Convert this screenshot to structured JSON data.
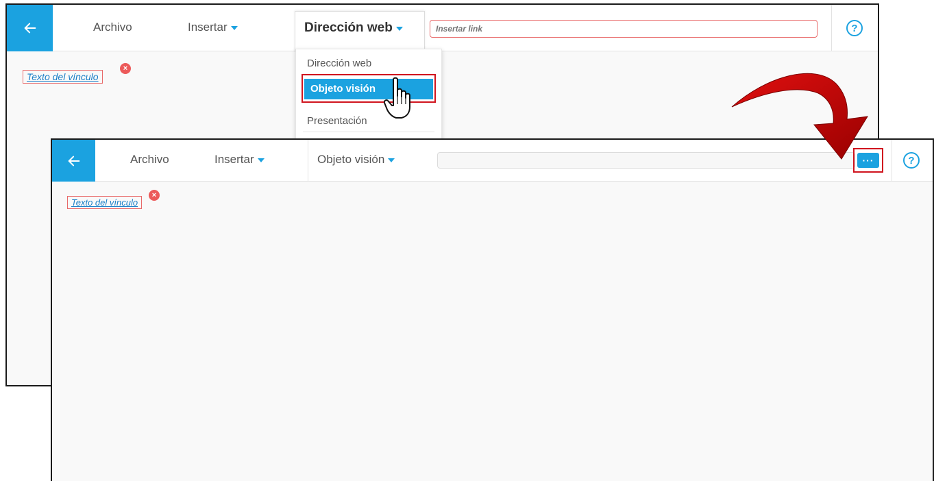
{
  "window1": {
    "menu": {
      "archivo": "Archivo",
      "insertar": "Insertar",
      "direccion_web": "Dirección web"
    },
    "url_input": {
      "placeholder": "Insertar link"
    },
    "dropdown": {
      "items": [
        "Dirección web",
        "Objeto visión",
        "Presentación"
      ]
    },
    "link_chip": {
      "text": "Texto del vínculo",
      "close_glyph": "×"
    },
    "help_glyph": "?"
  },
  "window2": {
    "menu": {
      "archivo": "Archivo",
      "insertar": "Insertar",
      "objeto_vision": "Objeto visión"
    },
    "url_input": {
      "value": ""
    },
    "more_button": {
      "label": "···"
    },
    "link_chip": {
      "text": "Texto del vínculo",
      "close_glyph": "×"
    },
    "help_glyph": "?"
  },
  "colors": {
    "accent": "#1ba2e0",
    "highlight_red": "#d0141e",
    "close_red": "#ec5a5a",
    "arrow_red": "#c80000"
  },
  "icons": [
    "back-arrow-icon",
    "caret-down-icon",
    "help-icon",
    "close-icon",
    "more-options-icon",
    "pointer-hand-icon",
    "curved-arrow-icon"
  ]
}
